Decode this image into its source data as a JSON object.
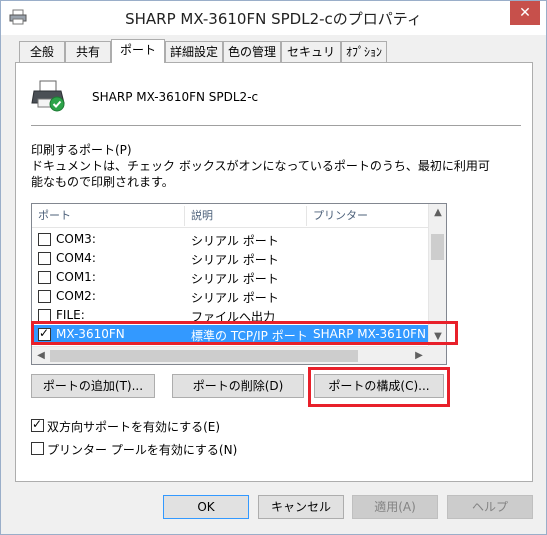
{
  "window": {
    "title": "SHARP MX-3610FN SPDL2-cのプロパティ",
    "close_glyph": "✕"
  },
  "tabs": [
    {
      "label": "全般"
    },
    {
      "label": "共有"
    },
    {
      "label": "ポート",
      "active": true
    },
    {
      "label": "詳細設定"
    },
    {
      "label": "色の管理"
    },
    {
      "label": "セキュリティ"
    },
    {
      "label": "ｵﾌﾟｼｮﾝ"
    }
  ],
  "printer": {
    "name": "SHARP MX-3610FN SPDL2-c",
    "icon": "printer-icon"
  },
  "ports_section": {
    "heading": "印刷するポート(P)",
    "description": "ドキュメントは、チェック ボックスがオンになっているポートのうち、最初に利用可能なもので印刷されます。"
  },
  "port_list": {
    "columns": [
      "ポート",
      "説明",
      "プリンター"
    ],
    "rows": [
      {
        "port": "COM3:",
        "desc": "シリアル ポート",
        "printer": "",
        "checked": false
      },
      {
        "port": "COM4:",
        "desc": "シリアル ポート",
        "printer": "",
        "checked": false
      },
      {
        "port": "COM1:",
        "desc": "シリアル ポート",
        "printer": "",
        "checked": false
      },
      {
        "port": "COM2:",
        "desc": "シリアル ポート",
        "printer": "",
        "checked": false
      },
      {
        "port": "FILE:",
        "desc": "ファイルへ出力",
        "printer": "",
        "checked": false
      },
      {
        "port": "MX-3610FN",
        "desc": "標準の TCP/IP ポート",
        "printer": "SHARP MX-3610FN",
        "checked": true,
        "selected": true
      }
    ]
  },
  "port_buttons": {
    "add": "ポートの追加(T)...",
    "delete": "ポートの削除(D)",
    "configure": "ポートの構成(C)..."
  },
  "options": {
    "bidirectional": {
      "label": "双方向サポートを有効にする(E)",
      "checked": true
    },
    "pooling": {
      "label": "プリンター プールを有効にする(N)",
      "checked": false
    }
  },
  "dialog_buttons": {
    "ok": "OK",
    "cancel": "キャンセル",
    "apply": "適用(A)",
    "help": "ヘルプ"
  },
  "colors": {
    "selection": "#3399ff",
    "highlight": "#e8202a",
    "close": "#c7504b"
  }
}
